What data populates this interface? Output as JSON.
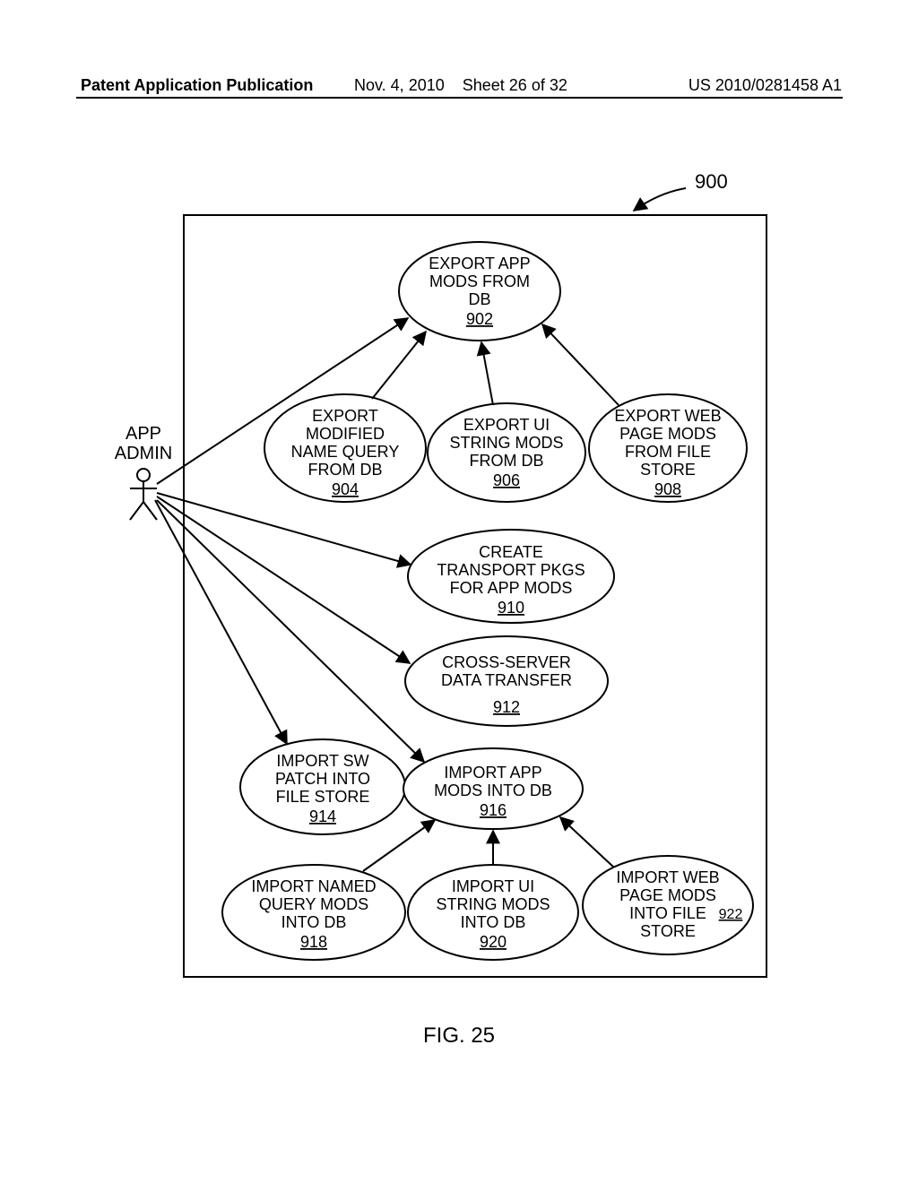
{
  "header": {
    "left": "Patent Application Publication",
    "date": "Nov. 4, 2010",
    "sheet": "Sheet 26 of 32",
    "pubnum": "US 2010/0281458 A1"
  },
  "pointer": {
    "label": "900"
  },
  "actor": {
    "line1": "APP",
    "line2": "ADMIN"
  },
  "nodes": {
    "902": {
      "l1": "EXPORT APP",
      "l2": "MODS FROM",
      "l3": "DB",
      "ref": "902"
    },
    "904": {
      "l1": "EXPORT",
      "l2": "MODIFIED",
      "l3": "NAME QUERY",
      "l4": "FROM DB",
      "ref": "904"
    },
    "906": {
      "l1": "EXPORT UI",
      "l2": "STRING MODS",
      "l3": "FROM DB",
      "ref": "906"
    },
    "908": {
      "l1": "EXPORT WEB",
      "l2": "PAGE MODS",
      "l3": "FROM FILE",
      "l4": "STORE",
      "ref": "908"
    },
    "910": {
      "l1": "CREATE",
      "l2": "TRANSPORT PKGS",
      "l3": "FOR APP MODS",
      "ref": "910"
    },
    "912": {
      "l1": "CROSS-SERVER",
      "l2": "DATA TRANSFER",
      "ref": "912"
    },
    "914": {
      "l1": "IMPORT SW",
      "l2": "PATCH INTO",
      "l3": "FILE STORE",
      "ref": "914"
    },
    "916": {
      "l1": "IMPORT APP",
      "l2": "MODS INTO DB",
      "ref": "916"
    },
    "918": {
      "l1": "IMPORT NAMED",
      "l2": "QUERY MODS",
      "l3": "INTO DB",
      "ref": "918"
    },
    "920": {
      "l1": "IMPORT UI",
      "l2": "STRING MODS",
      "l3": "INTO DB",
      "ref": "920"
    },
    "922": {
      "l1": "IMPORT WEB",
      "l2": "PAGE MODS",
      "l3": "INTO FILE",
      "l4": "STORE",
      "ref": "922"
    },
    "922side": "922"
  },
  "figcaption": "FIG. 25"
}
